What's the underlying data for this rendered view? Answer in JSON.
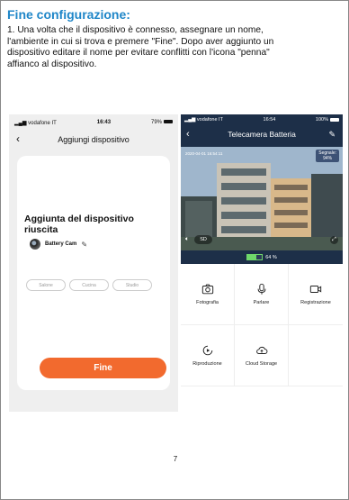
{
  "heading": "Fine configurazione:",
  "instructions": {
    "line1": "1. Una volta che il dispositivo è connesso, assegnare un nome,",
    "line2": "l'ambiente in cui si trova e premere \"Fine\". Dopo aver aggiunto un",
    "line3": "dispositivo editare il nome per evitare conflitti con l'icona \"penna\"",
    "line4": "affianco al dispositivo."
  },
  "left_phone": {
    "status": {
      "carrier": "vodafone IT",
      "time": "16:43",
      "battery": "79%"
    },
    "nav_title": "Aggiungi dispositivo",
    "success_text": "Aggiunta del dispositivo riuscita",
    "device_name": "Battery Cam",
    "rooms": [
      "Salone",
      "Cucina",
      "Studio"
    ],
    "done_button": "Fine"
  },
  "right_phone": {
    "status": {
      "carrier": "vodafone IT",
      "time": "16:54",
      "battery": "100%"
    },
    "nav_title": "Telecamera Batteria",
    "timestamp": "2020-04-01  16:54:11",
    "signal_label": "Segnale:",
    "signal_value": "94%",
    "quality": "SD",
    "battery_level": "64 %",
    "battery_fraction": 0.64,
    "functions": [
      {
        "label": "Fotografia",
        "icon": "camera-icon"
      },
      {
        "label": "Parlare",
        "icon": "microphone-icon"
      },
      {
        "label": "Registrazione",
        "icon": "video-record-icon"
      },
      {
        "label": "Riproduzione",
        "icon": "playback-icon"
      },
      {
        "label": "Cloud Storage",
        "icon": "cloud-icon"
      }
    ]
  },
  "page_number": "7",
  "colors": {
    "heading": "#1f86c8",
    "accent_orange": "#f26a2e",
    "camera_header": "#1d2f48",
    "battery_green": "#6fd76a"
  }
}
